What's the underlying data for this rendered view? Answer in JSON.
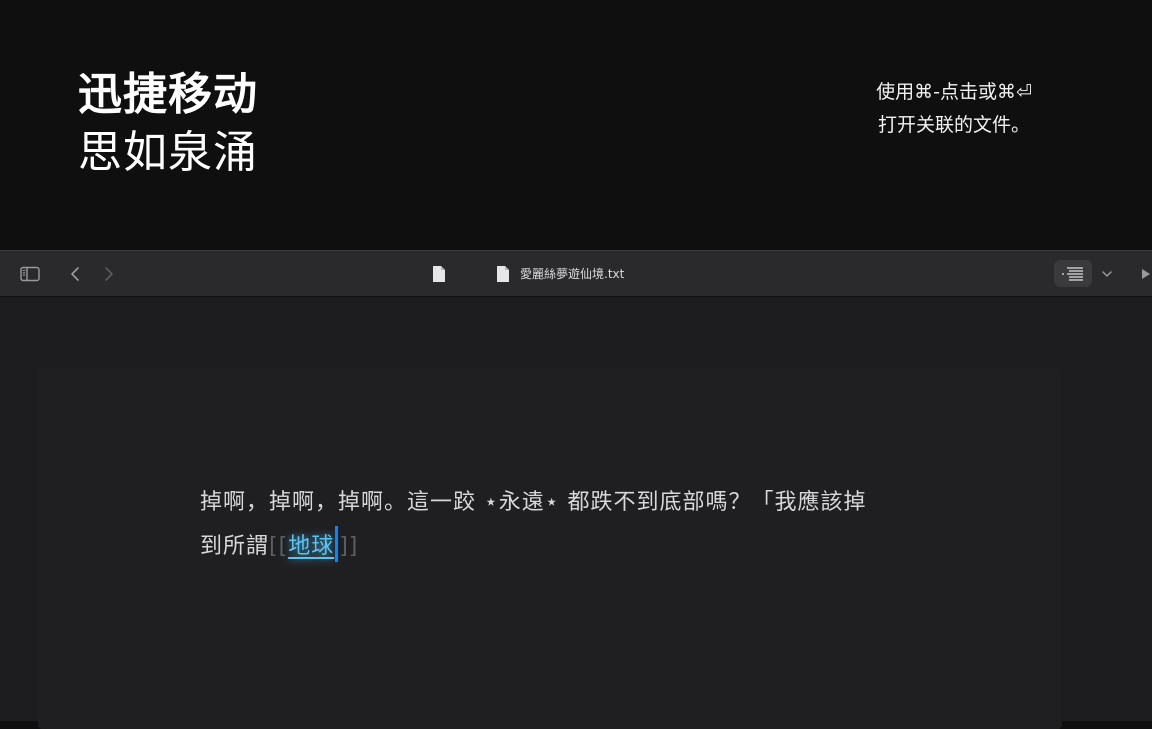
{
  "promo": {
    "headline_bold": "迅捷移动",
    "headline_regular": "思如泉涌",
    "hint_line1": "使用⌘-点击或⌘⏎",
    "hint_line2": "打开关联的文件。"
  },
  "toolbar": {
    "file_title": "愛麗絲夢遊仙境.txt",
    "icons": [
      "sidebar-toggle-icon",
      "back-chevron-icon",
      "forward-chevron-icon",
      "document-icon",
      "outline-list-icon",
      "chevron-down-icon",
      "play-icon"
    ]
  },
  "editor": {
    "line1": "掉啊，掉啊，掉啊。這一跤 ⋆永遠⋆ 都跌不到底部嗎？「我應該掉",
    "line2_prefix": "到所謂",
    "bracket_open": "[[",
    "link_text": "地球",
    "bracket_close": "]]"
  },
  "colors": {
    "link": "#58c4f5",
    "caret": "#0a84ff",
    "background": "#1d1d1f"
  }
}
